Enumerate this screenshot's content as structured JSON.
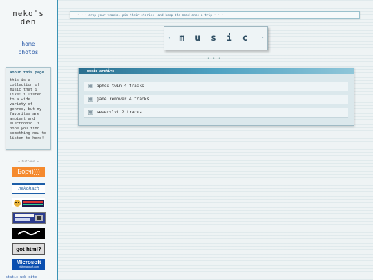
{
  "sidebar": {
    "title_line1": "neko's",
    "title_line2": "den",
    "nav": [
      {
        "label": "home"
      },
      {
        "label": "photos"
      }
    ],
    "about": {
      "title": "about this page",
      "text": "this is a collection of music that i like! i listen to a wide variety of genres, but my favorites are ambient and electronic. i hope you find something new to listen to here!"
    },
    "badges_label": "~ buttons ~",
    "badges": {
      "b1": "Борч))))",
      "b2": "nekohash",
      "b6": "got html?",
      "b7_title": "Microsoft",
      "b7_sub": "visit microsoft.com"
    },
    "cut_badge_text": "static web site"
  },
  "topbar": {
    "text": "• • • drop your tracks, pin their stories, and keep the mood once a trip • • •"
  },
  "logo": {
    "text": "music",
    "left_arrow": "◂",
    "right_arrow": "▸"
  },
  "deco_dots": "• • •",
  "archive": {
    "header": "music_archive",
    "tracks": [
      {
        "label": "aphex twin 4 tracks"
      },
      {
        "label": "jane remover 4 tracks"
      },
      {
        "label": "sewerslvt 2 tracks"
      }
    ]
  },
  "colors": {
    "accent": "#3a93b5",
    "link": "#2a5aa8",
    "header_gradient_start": "#2a6f8f"
  }
}
